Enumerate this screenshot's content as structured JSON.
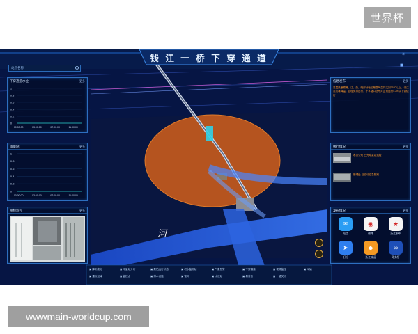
{
  "brand_badge": "世界杯",
  "url_badge": "wwwmain-worldcup.com",
  "dashboard": {
    "title": "钱 江 一 桥 下 穿 通 道",
    "search_placeholder": "站点名称",
    "river_label": "河",
    "panels": {
      "water_level": {
        "title": "下穿通道水位",
        "more": "更多",
        "yticks": [
          "1",
          "0.8",
          "0.6",
          "0.4",
          "0.2",
          "0"
        ],
        "xticks": [
          "00:00:00",
          "03:00:00",
          "07:00:00",
          "11:00:00"
        ]
      },
      "rain": {
        "title": "雨量站",
        "more": "更多",
        "yticks": [
          "1",
          "0.8",
          "0.6",
          "0.4",
          "0.2",
          "0"
        ],
        "xticks": [
          "00:00:00",
          "03:00:00",
          "07:00:00",
          "11:00:00"
        ]
      },
      "video": {
        "title": "视频监控",
        "more": "更多"
      },
      "news": {
        "title": "信息发布",
        "more": "更多",
        "text": "高温热浪预警，江、浙、皖部分地区最高气温将达到35℃以上，请注意防暑降温，合理安排出行，十字路口信号灯正常运行5.2m以下请绕行"
      },
      "patrol": {
        "title": "执行情况",
        "more": "更多",
        "lines": [
          "水务公司 已完成泵站巡检",
          "管理处 已启动应急预案"
        ]
      },
      "release": {
        "title": "发布情况",
        "more": "更多"
      }
    },
    "apps": [
      {
        "label": "短信",
        "color": "#2a9df4",
        "icon": "message-icon",
        "glyph": "✉"
      },
      {
        "label": "微博",
        "color": "#f5f5f5",
        "icon": "weibo-icon",
        "glyph": "◉"
      },
      {
        "label": "浙江发布",
        "color": "#f4f4f4",
        "icon": "zhejiang-icon",
        "glyph": "★"
      },
      {
        "label": "钉钉",
        "color": "#2f7ff0",
        "icon": "dingtalk-icon",
        "glyph": "➤"
      },
      {
        "label": "浙江城运",
        "color": "#f59a23",
        "icon": "city-icon",
        "glyph": "◆"
      },
      {
        "label": "政务钉",
        "color": "#1e4fb8",
        "icon": "infinity-icon",
        "glyph": "∞"
      }
    ],
    "toolbar": [
      "降雨变化",
      "雨量站分布",
      "泵站运行状态",
      "积水监测站",
      "气象预警",
      "下穿通道",
      "视频监控",
      "闸站",
      "重点区域",
      "监控点",
      "排水设施",
      "管网",
      "水位站",
      "易涝点",
      "一键关闭"
    ]
  }
}
